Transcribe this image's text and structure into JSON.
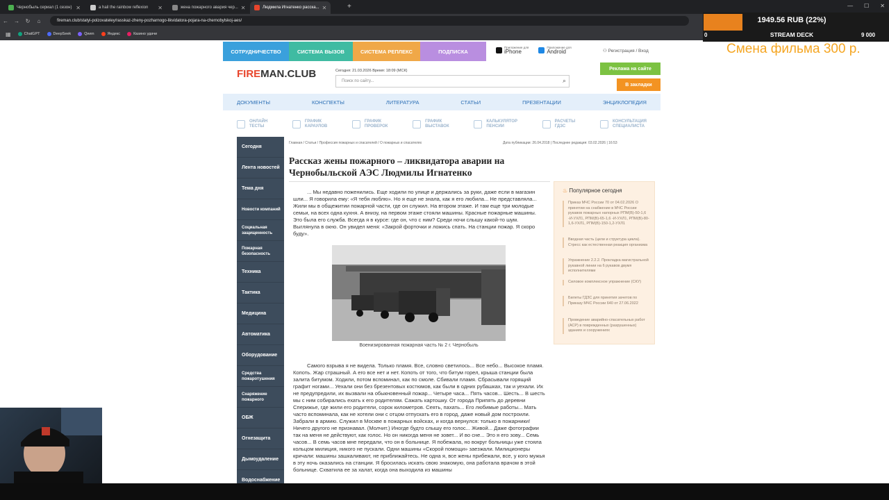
{
  "browser": {
    "tabs": [
      {
        "title": "Чернобыль сериал (1 сезон)",
        "active": false,
        "color": "#4caf50"
      },
      {
        "title": "a hail the rainbow reflexion",
        "active": false,
        "color": "#cccccc"
      },
      {
        "title": "жена пожарного авария чер...",
        "active": false,
        "color": "#888888"
      },
      {
        "title": "Людмила Игнатенко расска...",
        "active": true,
        "color": "#e8452c"
      }
    ],
    "url": "fireman.club/statyi-polzovateley/rasskaz-zheny-pozharnogo-likvidatora-pojara-na-chernobylskoj-aes/",
    "bookmarks": [
      {
        "label": "ChatGPT",
        "color": "#10a37f"
      },
      {
        "label": "DeepSeek",
        "color": "#4d6bfe"
      },
      {
        "label": "Qwen",
        "color": "#7b61ff"
      },
      {
        "label": "Яндекс",
        "color": "#fc3f1d"
      },
      {
        "label": "Казино удачи",
        "color": "#e91e63"
      }
    ]
  },
  "overlay": {
    "donation_amount": "1949.56 RUB (22%)",
    "donation_progress": 0.22,
    "donation_label": "STREAM DECK",
    "donation_min": "0",
    "donation_max": "9 000",
    "promo": "Смена фильма 300 р.",
    "accent": "#e8821e"
  },
  "site": {
    "topnav": [
      {
        "label": "СОТРУДНИЧЕСТВО",
        "color": "#3aa0dc"
      },
      {
        "label": "СИСТЕМА ВЫЗОВ",
        "color": "#3fbba2"
      },
      {
        "label": "СИСТЕМА РЕПЛЕКС",
        "color": "#f0a848"
      },
      {
        "label": "ПОДПИСКА",
        "color": "#b98ee0"
      }
    ],
    "apps": [
      {
        "sub": "Приложение для",
        "name": "iPhone",
        "color": "#111111"
      },
      {
        "sub": "Приложение для",
        "name": "Android",
        "color": "#1e88e5"
      }
    ],
    "login": "Регистрация / Вход",
    "logo_fire": "FIRE",
    "logo_rest": "MAN.CLUB",
    "datetime": "Сегодня: 21.03.2026 Время: 18:09 (МСК)",
    "search_placeholder": "Поиск по сайту...",
    "ads_button": "Реклама на сайте",
    "fav_button": "В закладки",
    "mainnav": [
      "ДОКУМЕНТЫ",
      "КОНСПЕКТЫ",
      "ЛИТЕРАТУРА",
      "СТАТЬИ",
      "ПРЕЗЕНТАЦИИ",
      "ЭНЦИКЛОПЕДИЯ"
    ],
    "services": [
      [
        "ОНЛАЙН",
        "ТЕСТЫ"
      ],
      [
        "ГРАФИК",
        "КАРАУЛОВ"
      ],
      [
        "ГРАФИК",
        "ПРОВЕРОК"
      ],
      [
        "ГРАФИК",
        "ВЫСТАВОК"
      ],
      [
        "КАЛЬКУЛЯТОР",
        "ПЕНСИИ"
      ],
      [
        "РАСЧЕТЫ",
        "ГДЗС"
      ],
      [
        "КОНСУЛЬТАЦИЯ",
        "СПЕЦИАЛИСТА"
      ]
    ],
    "sidebar": [
      "Сегодня",
      "Лента новостей",
      "Тема дня",
      "Новости компаний",
      "Социальная защищенность",
      "Пожарная безопасность",
      "Техника",
      "Тактика",
      "Медицина",
      "Автоматика",
      "Оборудование",
      "Средства пожаротушения",
      "Снаряжение пожарного",
      "ОБЖ",
      "Огнезащита",
      "Дымоудаление",
      "Водоснабжение"
    ]
  },
  "article": {
    "breadcrumb": "Главная / Статьи / Профессия пожарных и спасателей / О пожарных и спасателях",
    "pubinfo": "Дата публикации: 26.04.2018   |   Последнее редакция: 03.02.2026   |   16:53",
    "title": "Рассказ жены пожарного – ликвидатора аварии на Чернобыльской АЭС Людмилы Игнатенко",
    "p1": "... Мы недавно поженились. Еще ходили по улице и держались за руки, даже если в магазин шли... Я говорила ему: «Я тебя люблю». Но я еще не знала, как я его любила... Не представляла... Жили мы в общежитии пожарной части, где он служил. На втором этаже. И там еще три молодые семьи, на всех одна кухня. А внизу, на первом этаже стояли машины. Красные пожарные машины. Это была его служба. Всегда я в курсе: где он, что с ним? Среди ночи слышу какой-то шум. Выглянула в окно. Он увидел меня: «Закрой форточки и ложись спать. На станции пожар. Я скоро буду».",
    "caption": "Военизированная пожарная часть № 2 г. Чернобыль",
    "p2": "Самого взрыва я не видела. Только пламя. Все, словно светилось... Все небо... Высокое пламя. Копоть. Жар страшный. А его все нет и нет. Копоть от того, что битум горел, крыша станции была залита битумом. Ходили, потом вспоминал, как по смоле. Сбивали пламя. Сбрасывали горящий графит ногами... Уехали они без брезентовых костюмов, как были в одних рубашках, так и уехали. Их не предупредили, их вызвали на обыкновенный пожар... Четыре часа... Пять часов... Шесть... В шесть мы с ним собирались ехать к его родителям. Сажать картошку. От города Припять до деревни Сперижье, где жили его родители, сорок километров. Сеять, пахать... Его любимые работы... Мать часто вспоминала, как не хотели они с отцом отпускать его в город, даже новый дом построили. Забрали в армию. Служил в Москве в пожарных войсках, и когда вернулся: только в пожарники! Ничего другого не признавал. (Молчит.) Иногде будто слышу его голос... Живой... Даже фотографии так на меня не действуют, как голос. Но он никогда меня не зовет... И во сне... Это я его зову... Семь часов... В семь часов мне передали, что он в больнице. Я побежала, но вокруг больницы уже стояла кольцом милиция, никого не пускали. Одни машины «Скорой помощи» заезжали. Милиционеры кричали: машины зашкаливают, не приближайтесь. Не одна я, все жены прибежали, все, у кого мужья в эту ночь оказались на станции. Я бросилась искать свою знакомую, она работала врачом в этой больнице. Схватила ее за халат, когда она выходила из машины"
  },
  "popular": {
    "title": "Популярное сегодня",
    "items": [
      "Приказ МЧС России 70 от 04.02.2026 О принятии на снабжение в МЧС России рукавов пожарных напорных РПМ(В)-50-1,6 -И-УХЛ1, РПМ(В)-65-1,6 -И-УХЛ1, РПМ(В)-80-1,6-УХЛ1, РПМ(В)-150-1,2-УХЛ1",
      "Вводная часть (цели и структура цикла). Стресс как естественная реакция организма",
      "Упражнение 2.2.2. Прокладка магистральной рукавной линии на 6 рукавов двумя исполнителями",
      "Силовое комплексное упражнение (СКУ)",
      "Билеты ГДЗС для принятия зачетов по Приказу МЧС России 640 от 27.06.2022",
      "Проведение аварийно-спасательных работ (АСР) в поврежденных (разрушенных) зданиях и сооружениях"
    ]
  }
}
